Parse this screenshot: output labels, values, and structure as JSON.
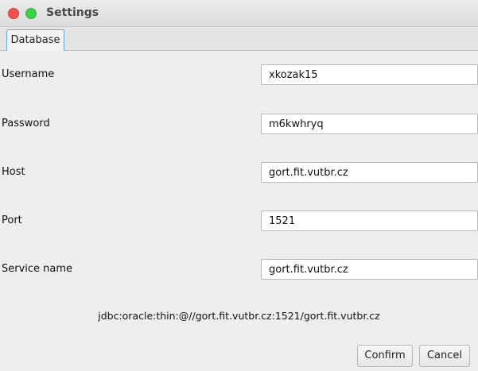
{
  "window": {
    "title": "Settings"
  },
  "tabs": [
    {
      "label": "Database",
      "selected": true
    }
  ],
  "form": {
    "username": {
      "label": "Username",
      "value": "xkozak15"
    },
    "password": {
      "label": "Password",
      "value": "m6kwhryq"
    },
    "host": {
      "label": "Host",
      "value": "gort.fit.vutbr.cz"
    },
    "port": {
      "label": "Port",
      "value": "1521"
    },
    "service": {
      "label": "Service name",
      "value": "gort.fit.vutbr.cz"
    }
  },
  "connection_string": "jdbc:oracle:thin:@//gort.fit.vutbr.cz:1521/gort.fit.vutbr.cz",
  "buttons": {
    "confirm": "Confirm",
    "cancel": "Cancel"
  },
  "colors": {
    "close_button": "#ef5350",
    "maximize_button": "#3fd04a",
    "tab_border_accent": "#6aa8d6"
  }
}
